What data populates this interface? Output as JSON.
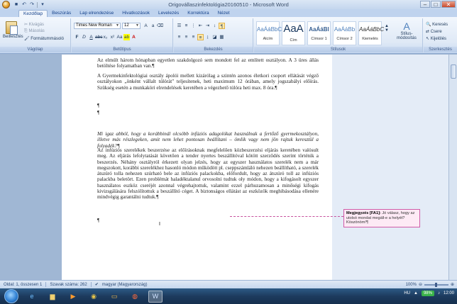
{
  "window": {
    "title": "Origovállaszinfektológia20160510 - Microsoft Word",
    "controls": [
      "–",
      "□",
      "✕"
    ]
  },
  "tabs": [
    "Kezdőlap",
    "Beszúrás",
    "Lap elrendezése",
    "Hivatkozások",
    "Levelezés",
    "Korrektúra",
    "Nézet"
  ],
  "active_tab": "Kezdőlap",
  "ribbon": {
    "clipboard": {
      "paste": "Beillesztés",
      "cut": "Kivágás",
      "copy": "Másolás",
      "format_painter": "Formátummásoló",
      "label": "Vágólap"
    },
    "font": {
      "font_name": "Times New Roman",
      "font_size": "12",
      "label": "Betűtípus"
    },
    "paragraph": {
      "label": "Bekezdés"
    },
    "styles": {
      "items": [
        {
          "sample": "AaÁáBbC",
          "name": "Alcím"
        },
        {
          "sample": "AaA",
          "name": "Cím"
        },
        {
          "sample": "AaÁáBl",
          "name": "Címsor 1"
        },
        {
          "sample": "AaÁáBb",
          "name": "Címsor 2"
        },
        {
          "sample": "AaÁáBbC",
          "name": "Kiemelés"
        }
      ],
      "change_styles": "Stílus-módosítás",
      "label": "Stílusok"
    },
    "editing": {
      "find": "Keresés",
      "replace": "Csere",
      "select": "Kijelölés",
      "label": "Szerkesztés"
    }
  },
  "document": {
    "paragraphs": [
      "Az elmúlt három hónapban egyetlen szakdolgozó sem mondott fel az említett osztályon. A 3 üres állás betöltése folyamatban van.¶",
      "A Gyermekinfektológiai osztály ápolói mellett kizárólag a szintén azonos életkori csoport ellátását végző osztályokon „önként vállalt túlórát\" teljesítenek, heti maximum 12 órában, amely jogszabályi előírás. Szükség esetén a munkaköri elrendelések keretében a végezhető túlóra heti max. 8 óra.¶",
      "¶",
      "¶",
      "Mi igaz abból, hogy a korábbinál olcsóbb infúziós adagolókat használnak a fertőző gyermekosztályon, illetve más részlegeken, amit nem lehet pontosan beállítani – ömlik vagy nem jön rajtuk keresztül a folyadék?¶",
      "Az infúziós szerelékek beszerzése az előírásoknak megfelelően közbeszerzési eljárás keretében valósult meg. Az eljárás lefolytatását követően a tender nyertes beszállítóval kötött szerződés szerint történik a beszerzés. Néhány osztályról érkezett olyan jelzés, hogy az egyszer használatos szerelék nem a már megszokott, korábbi szerelékhez hasonló módon működött pl. cseppszámláló nehezen beállítható, a szerelék átszúró tolla nehezen szúrható bele az infúziós palackokba, előfordult, hogy az átszúró toll az infúziós palackba beletört. Ezen problémát haladéktalanul orvosolni tudtuk oly módon, hogy a kifogásolt egyszer használatos eszköz cseréjét azonnal végrehajtottuk, valamint ezzel párhuzamosan a minőségi kifogás kivizsgálására felszólítottuk a beszállító céget. A biztonságos ellátást az eszközök meghibásodása ellenére mindvégig garantálni tudtuk.¶",
      "¶"
    ],
    "comment": {
      "author": "Megjegyzés [FA1]:",
      "text": "Jó válasz, hogy az utolsó mondat megáll-e a helyét? Köszönöm!¶"
    }
  },
  "statusbar": {
    "page": "Oldal: 1, összesen 1",
    "words": "Szavak száma: 262",
    "language": "magyar (Magyarország)",
    "zoom": "100%"
  },
  "taskbar": {
    "lang": "HU",
    "battery": "98%",
    "time": "12:00"
  }
}
